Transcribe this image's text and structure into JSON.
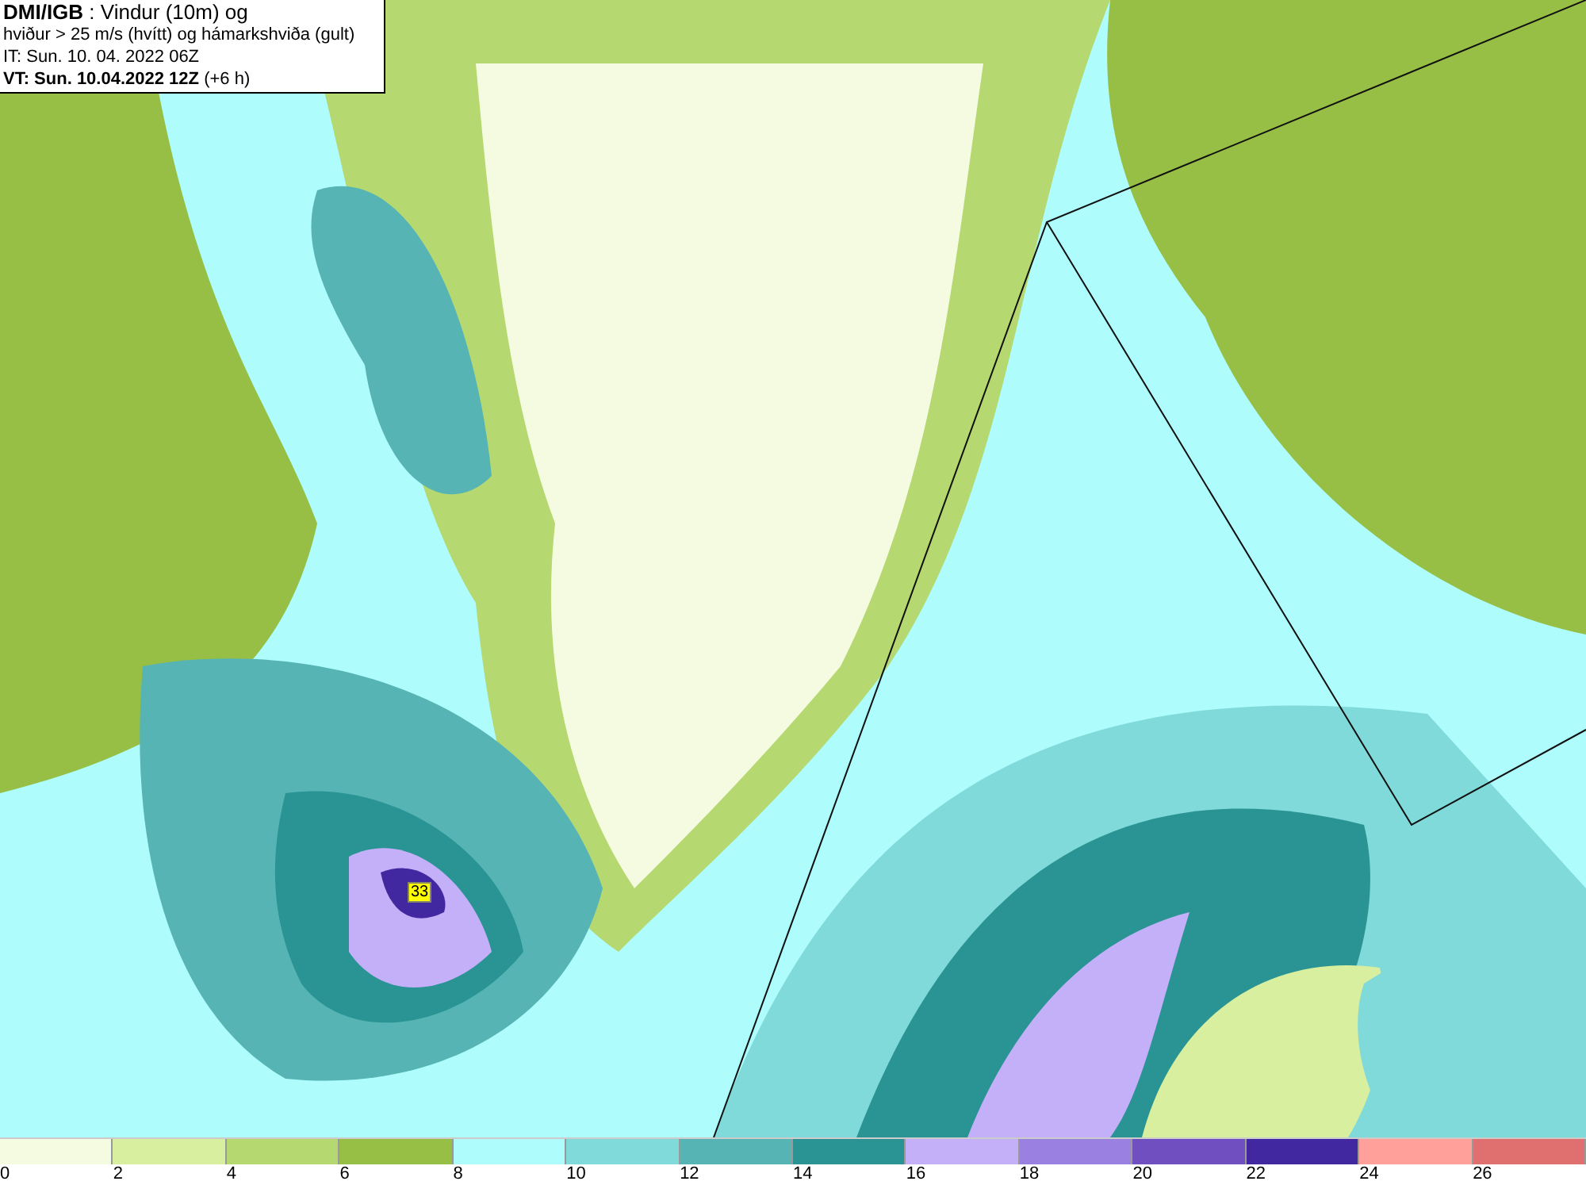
{
  "title_box": {
    "lines": [
      "**DMI/IGB** : Vindur (10m) og",
      "hviður > 25 m/s (hvítt) og hámarkshviða (gult)",
      "IT: Sun. 10. 04. 2022 06Z",
      "**VT: Sun. 10.04.2022 12Z** (+6 h)"
    ]
  },
  "map": {
    "max_gust_label": "33"
  },
  "legend": {
    "bins": [
      {
        "label": "0",
        "color": "#f5fbe0"
      },
      {
        "label": "2",
        "color": "#d8efa0"
      },
      {
        "label": "4",
        "color": "#b5d870"
      },
      {
        "label": "6",
        "color": "#98bf45"
      },
      {
        "label": "8",
        "color": "#aefcfc"
      },
      {
        "label": "10",
        "color": "#80dada"
      },
      {
        "label": "12",
        "color": "#56b4b4"
      },
      {
        "label": "14",
        "color": "#2a9494"
      },
      {
        "label": "16",
        "color": "#c3b0f8"
      },
      {
        "label": "18",
        "color": "#9a80e0"
      },
      {
        "label": "20",
        "color": "#7050c0"
      },
      {
        "label": "22",
        "color": "#4228a0"
      },
      {
        "label": "24",
        "color": "#ffa09a"
      },
      {
        "label": "26",
        "color": "#e07070"
      }
    ]
  }
}
